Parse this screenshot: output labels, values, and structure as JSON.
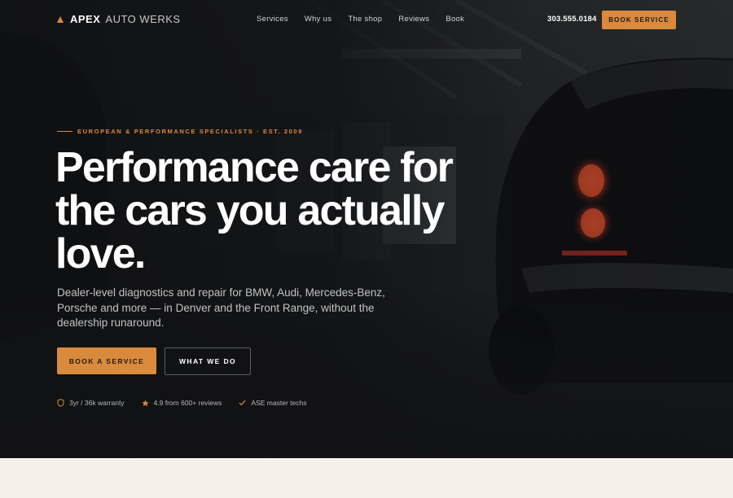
{
  "brand": {
    "name_strong": "APEX",
    "name_light": "AUTO WERKS",
    "accent": "#d98a3d"
  },
  "nav": {
    "links": [
      "Services",
      "Why us",
      "The shop",
      "Reviews",
      "Book"
    ],
    "phone": "303.555.0184",
    "cta_label": "BOOK SERVICE"
  },
  "hero": {
    "eyebrow": "EUROPEAN & PERFORMANCE SPECIALISTS · EST. 2009",
    "headline": "Performance care for the cars you actually love.",
    "subhead": "Dealer-level diagnostics and repair for BMW, Audi, Mercedes-Benz, Porsche and more — in Denver and the Front Range, without the dealership runaround.",
    "primary_cta": "BOOK A SERVICE",
    "secondary_cta": "WHAT WE DO",
    "trust": [
      {
        "icon": "shield-icon",
        "label": "3yr / 36k warranty"
      },
      {
        "icon": "star-icon",
        "label": "4.9 from 600+ reviews"
      },
      {
        "icon": "check-icon",
        "label": "ASE master techs"
      }
    ]
  },
  "colors": {
    "hero_bg": "#16191c",
    "section_bg": "#f4f0e8",
    "accent": "#d98a3d",
    "taillight": "#c33a22"
  }
}
